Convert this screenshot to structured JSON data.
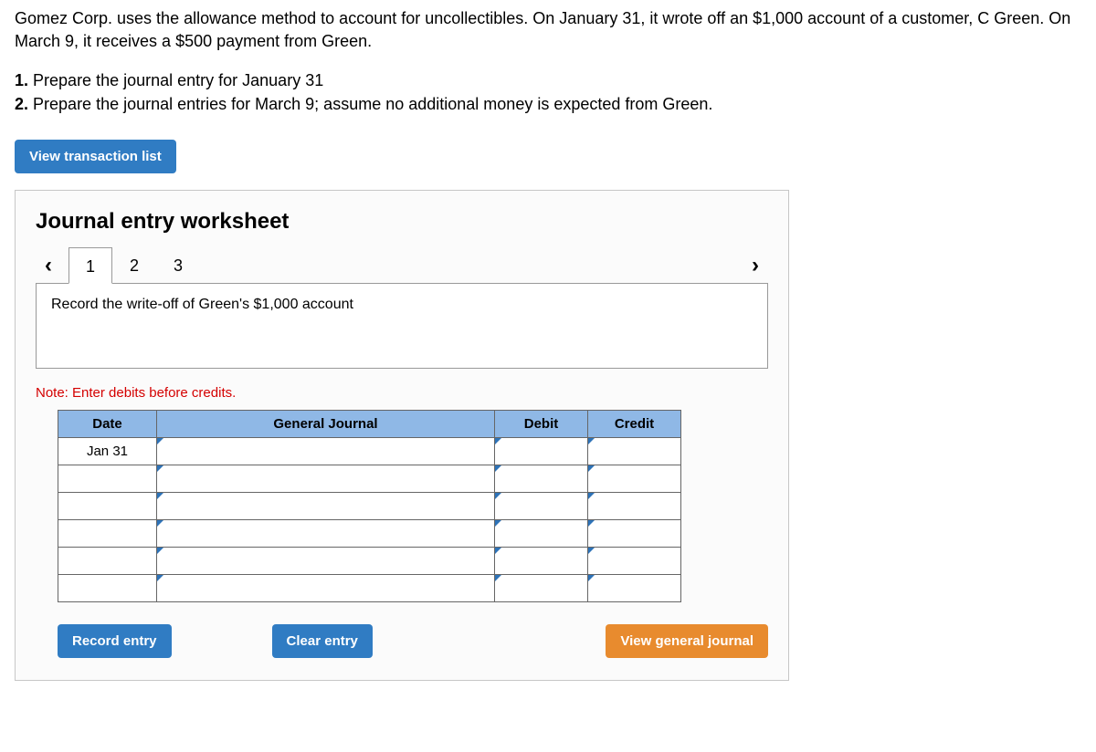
{
  "intro": "Gomez Corp. uses the allowance method to account for uncollectibles. On January 31, it wrote off an $1,000 account of a customer, C Green. On March 9, it receives a $500 payment from Green.",
  "tasks": [
    {
      "num": "1.",
      "text": "Prepare the journal entry for January 31"
    },
    {
      "num": "2.",
      "text": "Prepare the journal entries for March 9; assume no additional money is expected from Green."
    }
  ],
  "view_transaction_list": "View transaction list",
  "panel": {
    "title": "Journal entry worksheet",
    "tabs": [
      "1",
      "2",
      "3"
    ],
    "active_tab": 0,
    "instruction": "Record the write-off of Green's $1,000 account",
    "note": "Note: Enter debits before credits.",
    "headers": {
      "date": "Date",
      "gj": "General Journal",
      "debit": "Debit",
      "credit": "Credit"
    },
    "rows": [
      {
        "date": "Jan 31",
        "gj": "",
        "debit": "",
        "credit": ""
      },
      {
        "date": "",
        "gj": "",
        "debit": "",
        "credit": ""
      },
      {
        "date": "",
        "gj": "",
        "debit": "",
        "credit": ""
      },
      {
        "date": "",
        "gj": "",
        "debit": "",
        "credit": ""
      },
      {
        "date": "",
        "gj": "",
        "debit": "",
        "credit": ""
      },
      {
        "date": "",
        "gj": "",
        "debit": "",
        "credit": ""
      }
    ],
    "buttons": {
      "record": "Record entry",
      "clear": "Clear entry",
      "view_gj": "View general journal"
    }
  }
}
